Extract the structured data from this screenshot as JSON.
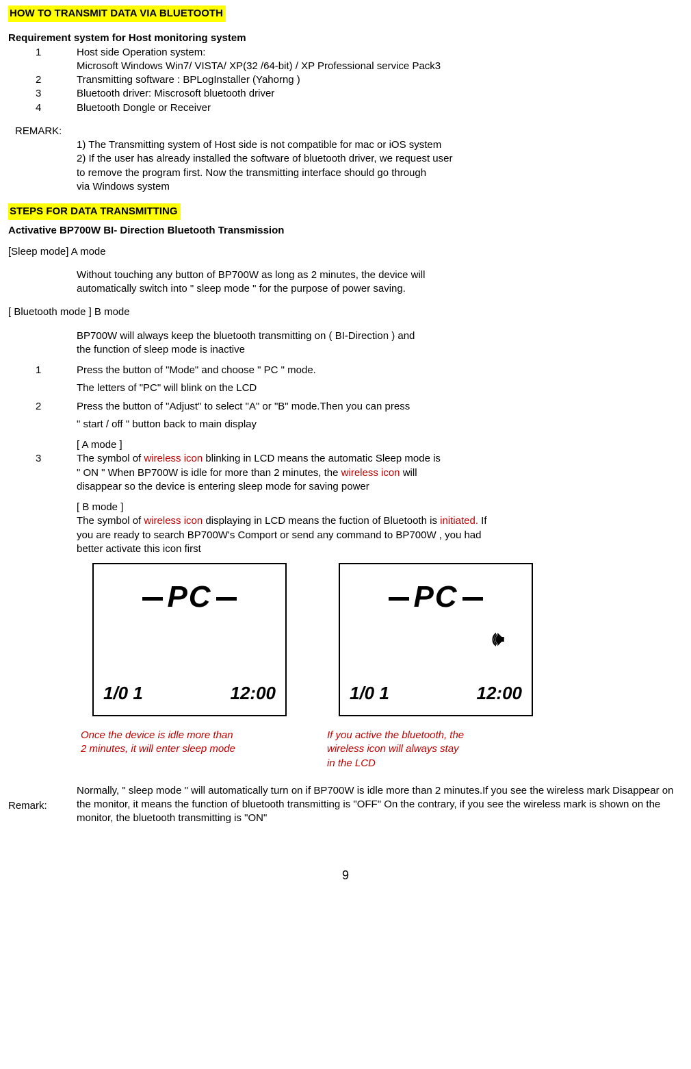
{
  "title1": "HOW TO TRANSMIT DATA VIA BLUETOOTH",
  "req_heading": "Requirement system for Host monitoring system",
  "req": {
    "n1": "1",
    "t1": "Host side Operation system:",
    "t1b": "Microsoft Windows Win7/ VISTA/ XP(32 /64-bit) / XP Professional service Pack3",
    "n2": "2",
    "t2": "Transmitting software : BPLogInstaller (Yahorng )",
    "n3": "3",
    "t3": "Bluetooth driver: Miscrosoft bluetooth driver",
    "n4": "4",
    "t4": "Bluetooth Dongle or Receiver"
  },
  "remark_label": "REMARK:",
  "remark1": "1) The Transmitting system of Host side is not compatible for mac or iOS system",
  "remark2": "2) If the user has already installed the software of bluetooth driver, we request user",
  "remark2b": "to remove the program first. Now the transmitting interface should go through",
  "remark2c": "via Windows system",
  "title2": "STEPS FOR DATA TRANSMITTING",
  "sub1": "Activative BP700W BI- Direction Bluetooth Transmission",
  "sleep_heading": "[Sleep mode] A mode",
  "sleep_t1": "Without touching any button of BP700W as long as 2 minutes, the device will",
  "sleep_t2": "automatically switch into \" sleep mode \" for the purpose of power saving.",
  "bt_heading": "[ Bluetooth mode ] B mode",
  "bt_t1": "BP700W will always keep the bluetooth transmitting on ( BI-Direction ) and",
  "bt_t2": "the function of sleep mode is inactive",
  "steps": {
    "s1n": "1",
    "s1a": "Press the button of \"Mode\" and choose \" PC \" mode.",
    "s1b": "The letters of \"PC\" will blink on the LCD",
    "s2n": "2",
    "s2a": "Press the button of \"Adjust\" to select \"A\" or \"B\"  mode.Then you can press",
    "s2b": " \" start / off \" button back to main display",
    "s3n": "3",
    "s3_a_head": "[ A mode ]",
    "s3_a_1a": "The symbol of ",
    "s3_a_1_red": "wireless icon",
    "s3_a_1b": " blinking in LCD means the automatic Sleep mode is",
    "s3_a_2a": "\" ON \" When BP700W is idle for more than 2 minutes, the ",
    "s3_a_2_red": "wireless icon",
    "s3_a_2b": " will",
    "s3_a_3": "disappear so the device is entering sleep mode for saving power",
    "s3_b_head": "[ B mode ]",
    "s3_b_1a": "The symbol of ",
    "s3_b_1_red": "wireless icon",
    "s3_b_1b": " displaying in LCD means the fuction of Bluetooth is ",
    "s3_b_1_red2": "initiated.",
    "s3_b_1c": " If",
    "s3_b_2": "you are ready to search BP700W's Comport or send any command to BP700W , you had",
    "s3_b_3": "better activate this icon first"
  },
  "lcd": {
    "pc": "PC",
    "date": "1/0 1",
    "time": "12:00",
    "wifi_glyph": "🕪"
  },
  "cap1a": "Once the device is idle more than",
  "cap1b": "2 minutes, it will enter sleep mode",
  "cap2a": "If you active the bluetooth, the",
  "cap2b": "wireless icon will always stay",
  "cap2c": "in the LCD",
  "remark2_label": "Remark:",
  "remark2_text": "Normally, \" sleep mode \" will automatically turn on if BP700W is idle more than 2 minutes.If you see the wireless mark Disappear on the monitor, it means the function of bluetooth transmitting is \"OFF\" On the contrary,  if you see the wireless mark is shown on the monitor, the bluetooth transmitting is \"ON\"",
  "page": "9"
}
